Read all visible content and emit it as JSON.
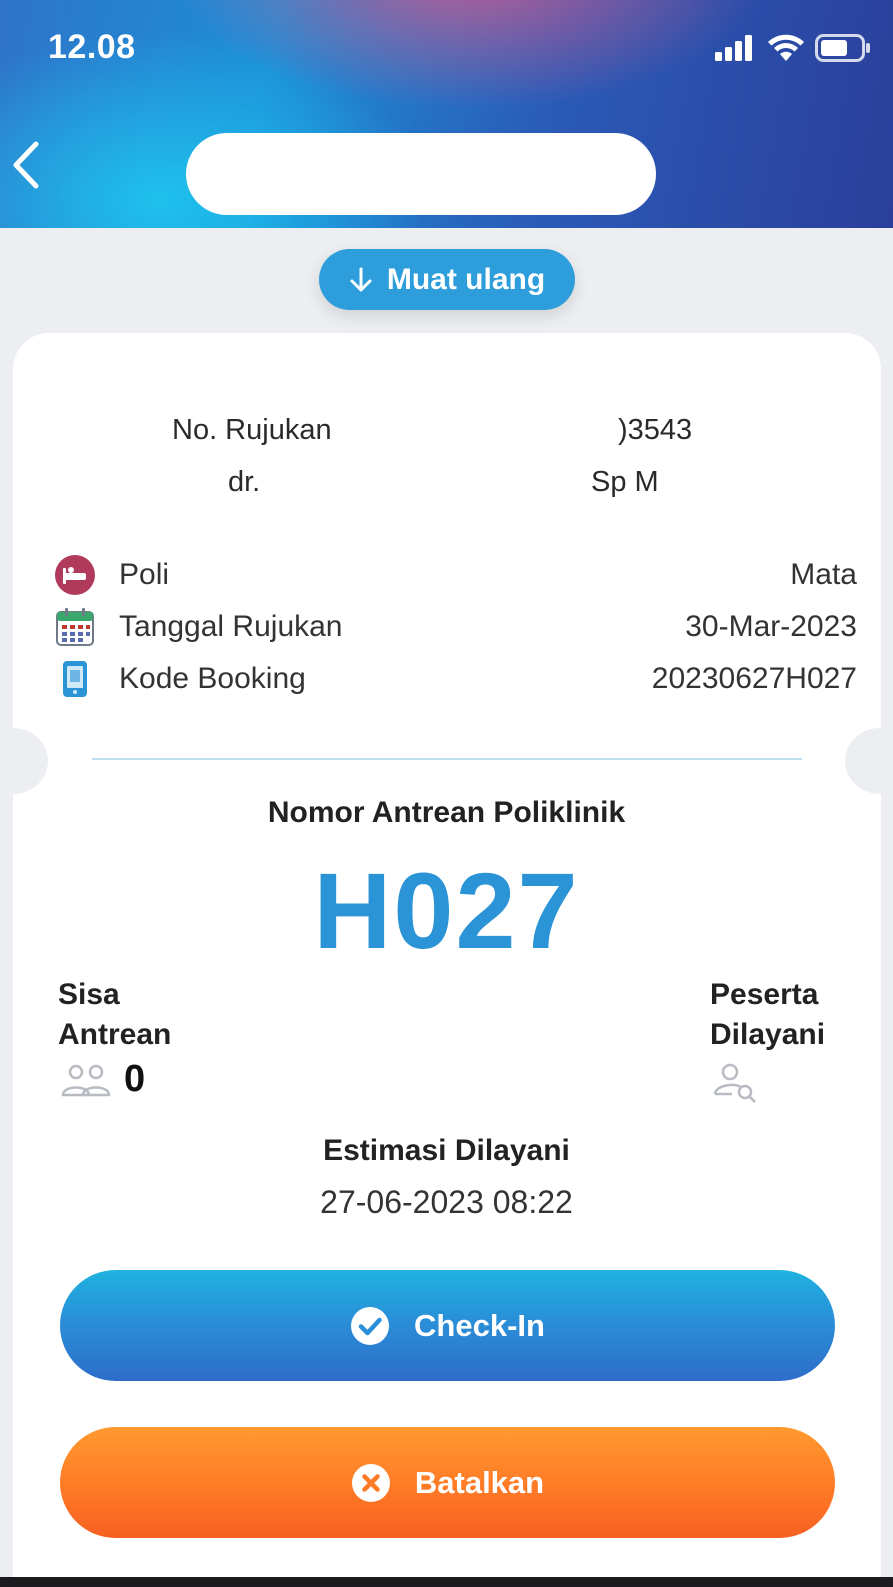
{
  "status_bar": {
    "time": "12.08",
    "icons": [
      "signal-icon",
      "wifi-icon",
      "battery-icon"
    ]
  },
  "header": {
    "back_icon": "chevron-left-icon",
    "title": ""
  },
  "reload": {
    "label": "Muat ulang",
    "icon": "arrow-down-icon"
  },
  "referral": {
    "label": "No. Rujukan",
    "number": ")3543",
    "doctor_prefix": "dr.",
    "doctor_suffix": "Sp M"
  },
  "info": [
    {
      "icon": "hospital-bed-icon",
      "label": "Poli",
      "value": "Mata"
    },
    {
      "icon": "calendar-icon",
      "label": "Tanggal Rujukan",
      "value": "30-Mar-2023"
    },
    {
      "icon": "phone-icon",
      "label": "Kode Booking",
      "value": "20230627H027"
    }
  ],
  "queue": {
    "title": "Nomor Antrean Poliklinik",
    "number": "H027",
    "remaining_label_1": "Sisa",
    "remaining_label_2": "Antrean",
    "remaining_count": "0",
    "served_label_1": "Peserta",
    "served_label_2": "Dilayani",
    "estimate_title": "Estimasi Dilayani",
    "estimate_value": "27-06-2023 08:22"
  },
  "buttons": {
    "checkin": "Check-In",
    "cancel": "Batalkan"
  },
  "colors": {
    "accent_blue": "#2b94d6",
    "cancel_orange": "#ff7a26",
    "poli_icon": "#b03a5b"
  }
}
